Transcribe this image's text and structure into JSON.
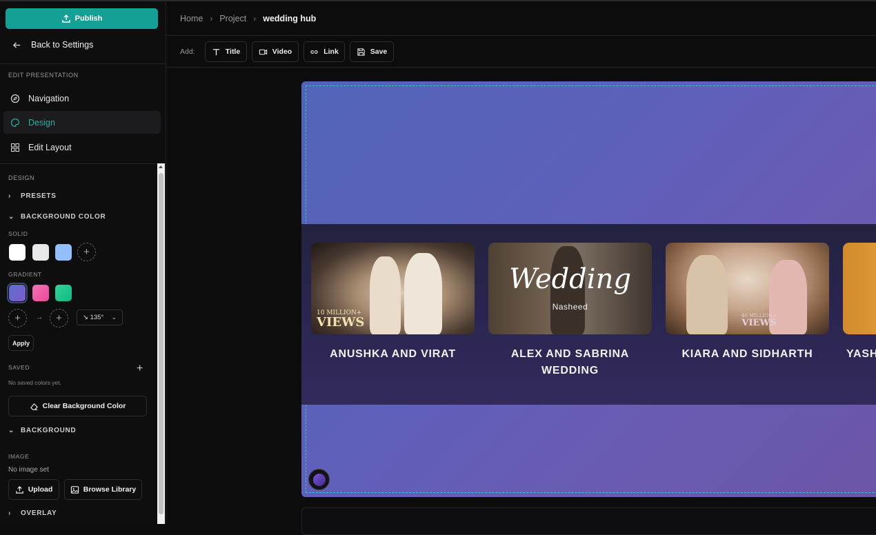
{
  "sidebar": {
    "publish_label": "Publish",
    "back_label": "Back to Settings",
    "edit_section": "EDIT PRESENTATION",
    "nav": [
      {
        "label": "Navigation"
      },
      {
        "label": "Design"
      },
      {
        "label": "Edit Layout"
      }
    ],
    "design_section": "DESIGN",
    "presets_label": "PRESETS",
    "bg_color_label": "BACKGROUND COLOR",
    "solid_label": "SOLID",
    "solid_colors": [
      "#ffffff",
      "#e8e8ea",
      "#93c0fb"
    ],
    "gradient_label": "GRADIENT",
    "gradient_colors": [
      "#6c6fd8",
      "#f472b6",
      "#34d399"
    ],
    "angle_value": "↘ 135°",
    "apply_label": "Apply",
    "saved_label": "SAVED",
    "no_saved": "No saved colors yet.",
    "clear_label": "Clear Background Color",
    "background_label": "BACKGROUND",
    "image_label": "IMAGE",
    "no_image": "No image set",
    "upload_label": "Upload",
    "browse_label": "Browse Library",
    "overlay_label": "OVERLAY"
  },
  "header": {
    "breadcrumb": [
      "Home",
      "Project",
      "wedding hub"
    ]
  },
  "toolbar": {
    "add_label": "Add:",
    "buttons": [
      "Title",
      "Video",
      "Link",
      "Save"
    ]
  },
  "cards": [
    {
      "title": "ANUSHKA AND VIRAT",
      "overlay_small": "10 MILLION+",
      "overlay_big": "VIEWS"
    },
    {
      "title": "ALEX AND SABRINA WEDDING",
      "script": "Wedding",
      "sub": "Nasheed"
    },
    {
      "title": "KIARA AND SIDHARTH",
      "overlay_small": "40 MILLION+",
      "overlay_big": "VIEWS"
    },
    {
      "title": "YASH"
    }
  ],
  "colors": {
    "accent": "#14a094",
    "active_text": "#1fb3a5"
  }
}
